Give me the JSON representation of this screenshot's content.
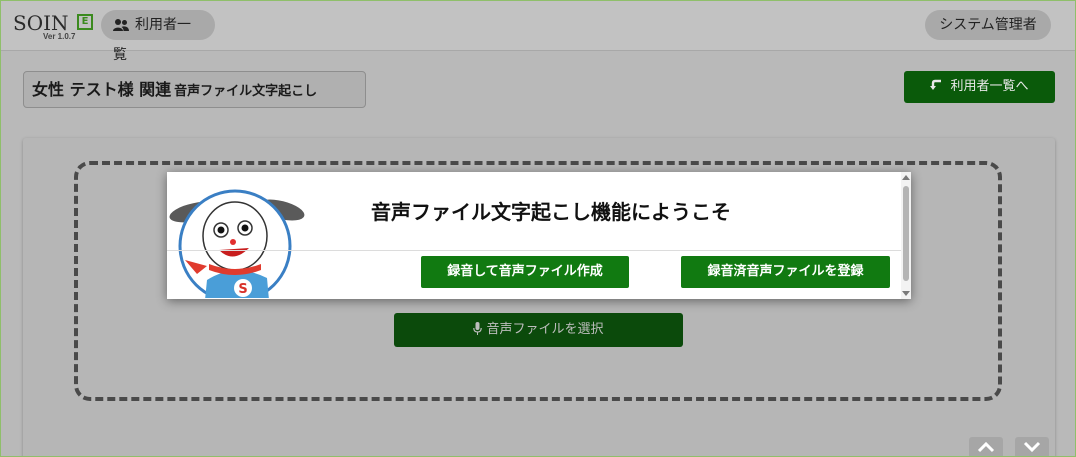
{
  "header": {
    "logo_text": "SOIN",
    "logo_badge": "E",
    "version": "Ver 1.0.7",
    "users_list_label": "利用者一覧",
    "admin_label": "システム管理者"
  },
  "page": {
    "title_main": "女性 テスト様 関連",
    "title_sub": "音声ファイル文字起こし",
    "back_button_label": "利用者一覧へ"
  },
  "dropzone": {
    "select_button_label": "音声ファイルを選択"
  },
  "modal": {
    "title": "音声ファイル文字起こし機能にようこそ",
    "record_button_label": "録音して音声ファイル作成",
    "register_button_label": "録音済音声ファイルを登録",
    "mascot_badge": "S"
  },
  "colors": {
    "primary_green": "#117a11",
    "dark_green": "#0a5a0a",
    "overlay_gray": "#b9b9b9"
  },
  "icons": {
    "users": "people-icon",
    "back": "return-arrow-icon",
    "mic": "microphone-icon",
    "scroll_up": "chevron-up-icon",
    "scroll_down": "chevron-down-icon"
  }
}
